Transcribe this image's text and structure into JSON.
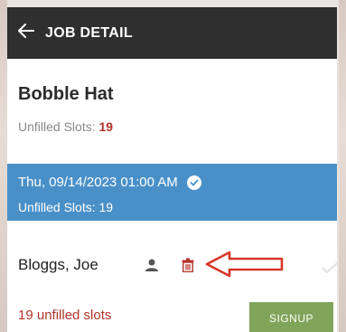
{
  "header": {
    "title": "JOB DETAIL",
    "back_icon": "arrow-left-icon"
  },
  "job": {
    "title": "Bobble Hat",
    "unfilled_label": "Unfilled Slots:",
    "unfilled_count": "19"
  },
  "slot": {
    "datetime": "Thu, 09/14/2023 01:00 AM",
    "unfilled_text": "Unfilled Slots: 19",
    "status_icon": "check-circle-icon",
    "background_color": "#4a90c8"
  },
  "signup_row": {
    "name": "Bloggs, Joe",
    "person_icon": "person-icon",
    "delete_icon": "trash-icon",
    "annotation_icon": "red-arrow-left-icon"
  },
  "footer": {
    "unfilled_text": "19 unfilled slots",
    "signup_label": "SIGNUP"
  },
  "colors": {
    "header_bg": "#2f2f2f",
    "accent_red": "#b3322a",
    "signup_green": "#80a45a"
  }
}
